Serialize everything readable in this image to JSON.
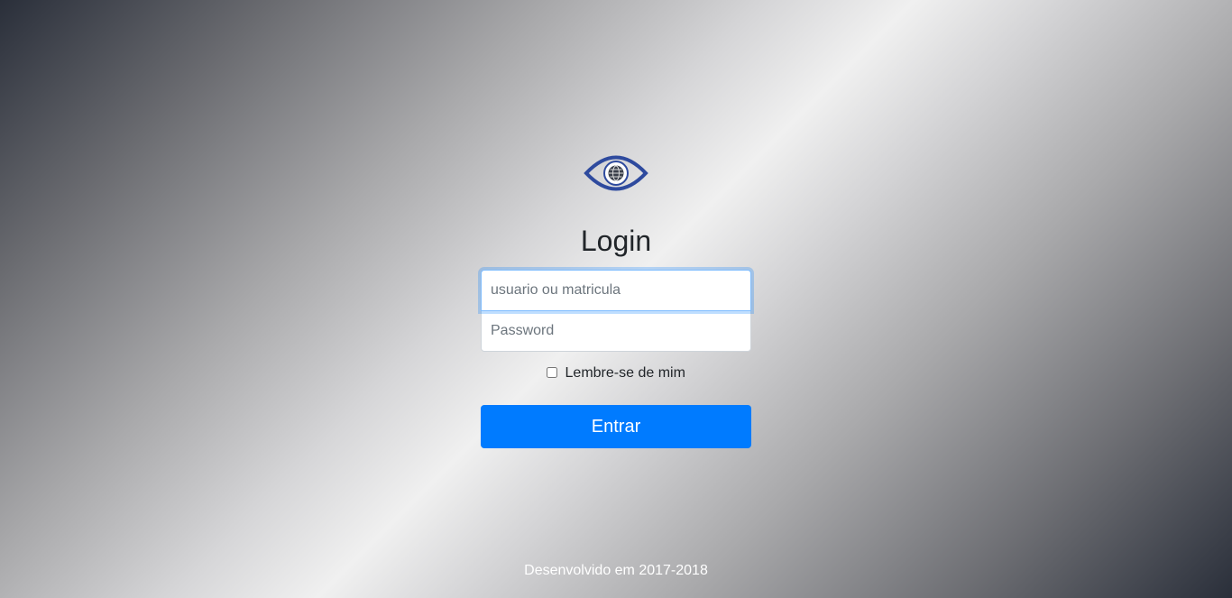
{
  "login": {
    "title": "Login",
    "username_placeholder": "usuario ou matricula",
    "password_placeholder": "Password",
    "remember_label": "Lembre-se de mim",
    "submit_label": "Entrar"
  },
  "logo": {
    "icon": "eye-globe-icon",
    "color": "#2e4a9e"
  },
  "footer": {
    "text": "Desenvolvido em 2017-2018"
  },
  "colors": {
    "primary_button": "#007bff",
    "focus_border": "#80bdff",
    "text": "#212529"
  }
}
